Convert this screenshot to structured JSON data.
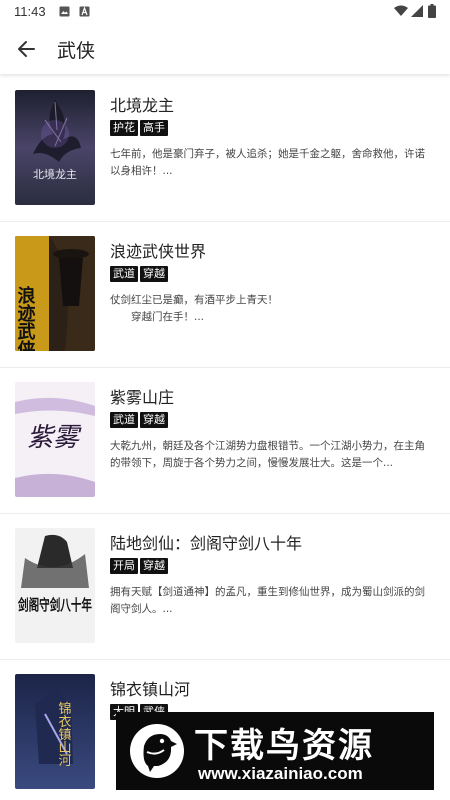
{
  "status_bar": {
    "time": "11:43"
  },
  "header": {
    "title": "武侠"
  },
  "books": [
    {
      "title": "北境龙主",
      "tags": [
        "护花",
        "高手"
      ],
      "desc": "七年前，他是豪门弃子，被人追杀；她是千金之躯，舍命救他，许诺以身相许！..."
    },
    {
      "title": "浪迹武侠世界",
      "tags": [
        "武道",
        "穿越"
      ],
      "desc": "仗剑红尘已是癫，有酒平步上青天！\n　　穿越门在手！..."
    },
    {
      "title": "紫雾山庄",
      "tags": [
        "武道",
        "穿越"
      ],
      "desc": "大乾九州，朝廷及各个江湖势力盘根错节。一个江湖小势力，在主角的带领下，周旋于各个势力之间，慢慢发展壮大。这是一个..."
    },
    {
      "title": "陆地剑仙：剑阁守剑八十年",
      "tags": [
        "开局",
        "穿越"
      ],
      "desc": "拥有天赋【剑道通神】的孟凡，重生到修仙世界，成为蜀山剑派的剑阁守剑人。..."
    },
    {
      "title": "锦衣镇山河",
      "tags": [
        "大明",
        "武侠"
      ],
      "desc": ""
    }
  ],
  "covers": [
    {
      "text": "北境龙主",
      "palette": [
        "#2a2d3e",
        "#5a4d7a",
        "#c8a8e8"
      ]
    },
    {
      "text": "浪迹武侠",
      "palette": [
        "#2b2117",
        "#c99a1a",
        "#f0d34a"
      ]
    },
    {
      "text": "紫雾",
      "palette": [
        "#f2eef6",
        "#8a5fa8",
        "#2a1a3a"
      ]
    },
    {
      "text": "剑阁守剑八十年",
      "palette": [
        "#f4f4f4",
        "#3a3a3a",
        "#111111"
      ]
    },
    {
      "text": "锦衣镇山河",
      "palette": [
        "#3a4a80",
        "#6a6ab0",
        "#e8c860"
      ]
    }
  ],
  "watermark": {
    "title": "下载鸟资源",
    "url": "www.xiazainiao.com"
  },
  "colors": {
    "tag_bg": "#111111",
    "divider": "#ececec"
  }
}
